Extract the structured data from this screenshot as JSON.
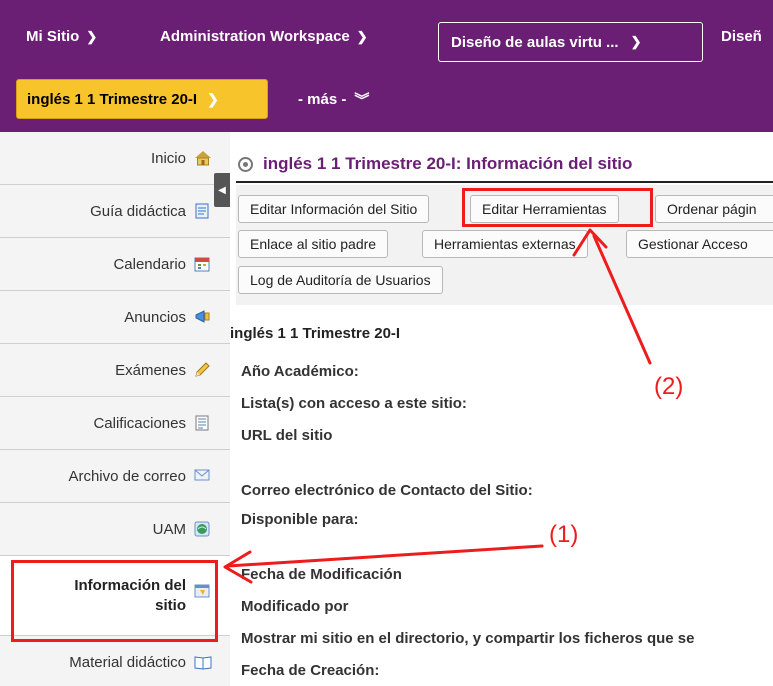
{
  "topnav": {
    "my_site": "Mi Sitio",
    "admin_workspace": "Administration Workspace",
    "course_design": "Diseño de aulas virtu ...",
    "course_design_2": "Diseñ",
    "current_site": "inglés 1 1 Trimestre 20-I",
    "more": "- más -"
  },
  "tools": [
    {
      "label": "Inicio",
      "icon": "home-icon"
    },
    {
      "label": "Guía didáctica",
      "icon": "document-icon"
    },
    {
      "label": "Calendario",
      "icon": "calendar-icon"
    },
    {
      "label": "Anuncios",
      "icon": "megaphone-icon"
    },
    {
      "label": "Exámenes",
      "icon": "pencil-icon"
    },
    {
      "label": "Calificaciones",
      "icon": "gradebook-icon"
    },
    {
      "label": "Archivo de correo",
      "icon": "mail-icon"
    },
    {
      "label": "UAM",
      "icon": "globe-icon"
    },
    {
      "label_line1": "Información del",
      "label_line2": "sitio",
      "icon": "site-info-icon",
      "active": true
    },
    {
      "label": "Material didáctico",
      "icon": "book-icon"
    }
  ],
  "main": {
    "title": "inglés 1 1 Trimestre 20-I: Información del sitio",
    "buttons": {
      "edit_site_info": "Editar Información del Sitio",
      "edit_tools": "Editar Herramientas",
      "order_pages": "Ordenar págin",
      "parent_link": "Enlace al sitio padre",
      "external_tools": "Herramientas externas",
      "manage_access": "Gestionar Acceso",
      "audit_log": "Log de Auditoría de Usuarios"
    },
    "site_name": "inglés 1 1 Trimestre 20-I",
    "fields": {
      "academic_year": "Año Académico:",
      "rosters": "Lista(s) con acceso a este sitio:",
      "site_url": "URL del sitio",
      "contact_email": "Correo electrónico de Contacto del Sitio:",
      "available_for": "Disponible para:",
      "modified_date": "Fecha de Modificación",
      "modified_by": "Modificado por",
      "show_in_directory": "Mostrar mi sitio en el directorio, y compartir los ficheros que se",
      "created_date": "Fecha de Creación:"
    }
  },
  "annotations": {
    "label_1": "(1)",
    "label_2": "(2)",
    "color": "#ee1c1c"
  },
  "colors": {
    "brand_purple": "#6a1e74",
    "current_site_yellow": "#f7c52b"
  }
}
